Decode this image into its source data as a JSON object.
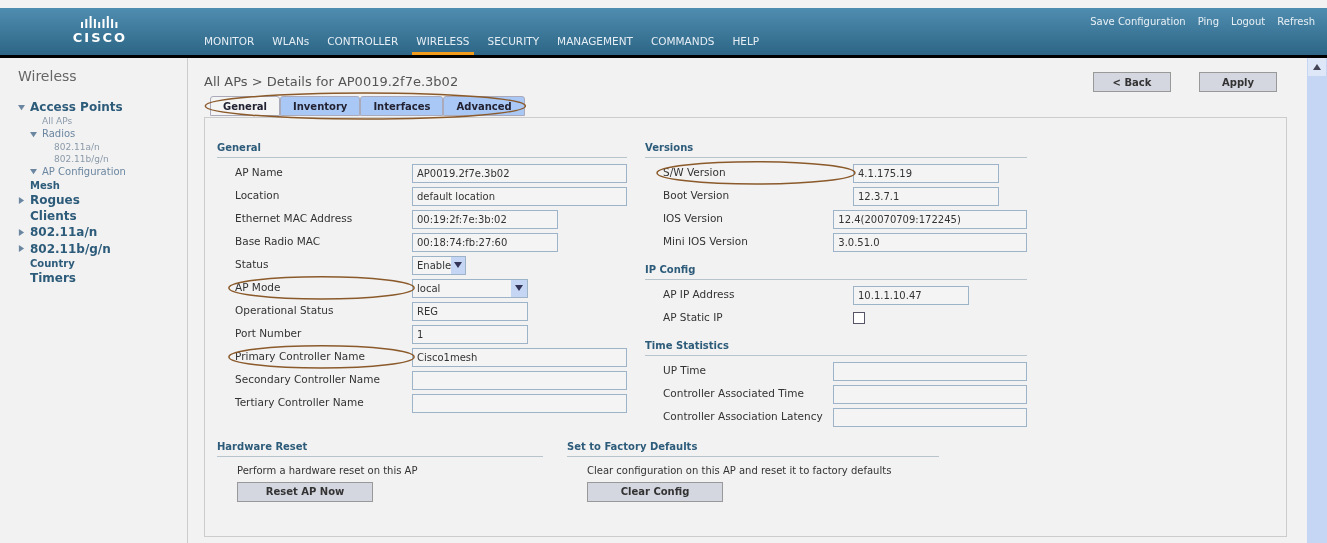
{
  "header": {
    "logo": "CISCO",
    "links": [
      {
        "label": "Save Configuration"
      },
      {
        "label": "Ping"
      },
      {
        "label": "Logout"
      },
      {
        "label": "Refresh"
      }
    ],
    "nav": [
      {
        "label": "MONITOR",
        "selected": false
      },
      {
        "label": "WLANs",
        "selected": false
      },
      {
        "label": "CONTROLLER",
        "selected": false
      },
      {
        "label": "WIRELESS",
        "selected": true
      },
      {
        "label": "SECURITY",
        "selected": false
      },
      {
        "label": "MANAGEMENT",
        "selected": false
      },
      {
        "label": "COMMANDS",
        "selected": false
      },
      {
        "label": "HELP",
        "selected": false
      }
    ]
  },
  "sidebar": {
    "title": "Wireless",
    "items": [
      {
        "label": "Access Points",
        "kind": "section",
        "expanded": true,
        "children": [
          {
            "label": "All APs",
            "kind": "link"
          },
          {
            "label": "Radios",
            "kind": "group",
            "expanded": true,
            "children": [
              {
                "label": "802.11a/n",
                "kind": "link"
              },
              {
                "label": "802.11b/g/n",
                "kind": "link"
              }
            ]
          },
          {
            "label": "AP Configuration",
            "kind": "group",
            "expanded": true
          }
        ]
      },
      {
        "label": "Mesh",
        "kind": "small"
      },
      {
        "label": "Rogues",
        "kind": "section",
        "expanded": false
      },
      {
        "label": "Clients",
        "kind": "section"
      },
      {
        "label": "802.11a/n",
        "kind": "section",
        "expanded": false
      },
      {
        "label": "802.11b/g/n",
        "kind": "section",
        "expanded": false
      },
      {
        "label": "Country",
        "kind": "small"
      },
      {
        "label": "Timers",
        "kind": "section"
      }
    ]
  },
  "page": {
    "title": "All APs > Details for AP0019.2f7e.3b02",
    "buttons": [
      "< Back",
      "Apply"
    ],
    "tabs": {
      "circled": true,
      "items": [
        {
          "label": "General",
          "selected": true
        },
        {
          "label": "Inventory",
          "selected": false
        },
        {
          "label": "Interfaces",
          "selected": false
        },
        {
          "label": "Advanced",
          "selected": false
        }
      ]
    }
  },
  "left_sections": [
    {
      "title": "General",
      "fields": [
        {
          "label": "AP Name",
          "kind": "long-text",
          "value": "AP0019.2f7e.3b02",
          "circled": false
        },
        {
          "label": "Location",
          "kind": "long-text",
          "value": "default location",
          "circled": false
        },
        {
          "label": "Ethernet MAC Address",
          "kind": "short-text",
          "value": "00:19:2f:7e:3b:02",
          "circled": false
        },
        {
          "label": "Base Radio MAC",
          "kind": "short-text",
          "value": "00:18:74:fb:27:60",
          "circled": false
        },
        {
          "label": "Status",
          "kind": "small-select",
          "value": "Enable",
          "circled": false
        },
        {
          "label": "AP Mode",
          "kind": "select",
          "value": "local",
          "circled": true
        },
        {
          "label": "Operational Status",
          "kind": "medium-text",
          "value": "REG",
          "circled": false
        },
        {
          "label": "Port Number",
          "kind": "medium-text",
          "value": "1",
          "circled": false
        },
        {
          "label": "Primary Controller Name",
          "kind": "long-text",
          "value": "Cisco1mesh",
          "circled": true
        },
        {
          "label": "Secondary Controller Name",
          "kind": "long-text",
          "circled": false
        },
        {
          "label": "Tertiary Controller Name",
          "kind": "long-text",
          "circled": false
        }
      ]
    }
  ],
  "right_sections": [
    {
      "title": "Versions",
      "fields": [
        {
          "label": "S/W Version",
          "kind": "short-text",
          "value": "4.1.175.19",
          "circled": true
        },
        {
          "label": "Boot Version",
          "kind": "short-text",
          "value": "12.3.7.1",
          "circled": false
        },
        {
          "label": "IOS Version",
          "kind": "long-text",
          "value": "12.4(20070709:172245)",
          "circled": false
        },
        {
          "label": "Mini IOS Version",
          "kind": "long-text",
          "value": "3.0.51.0",
          "circled": false
        }
      ]
    },
    {
      "title": "IP Config",
      "fields": [
        {
          "label": "AP IP Address",
          "kind": "medium-text",
          "value": "10.1.1.10.47",
          "circled": false
        },
        {
          "label": "AP Static IP",
          "kind": "checkbox",
          "checked": false,
          "circled": false
        }
      ]
    },
    {
      "title": "Time Statistics",
      "fields": [
        {
          "label": "UP Time",
          "kind": "long-text",
          "circled": false
        },
        {
          "label": "Controller Associated Time",
          "kind": "long-text",
          "circled": false
        },
        {
          "label": "Controller Association Latency",
          "kind": "long-text",
          "circled": false
        }
      ]
    }
  ],
  "actions": [
    {
      "title": "Hardware Reset",
      "text": "Perform a hardware reset on this AP",
      "button": "Reset AP Now"
    },
    {
      "title": "Set to Factory Defaults",
      "text": "Clear configuration on this AP and reset it to factory defaults",
      "button": "Clear Config"
    }
  ]
}
